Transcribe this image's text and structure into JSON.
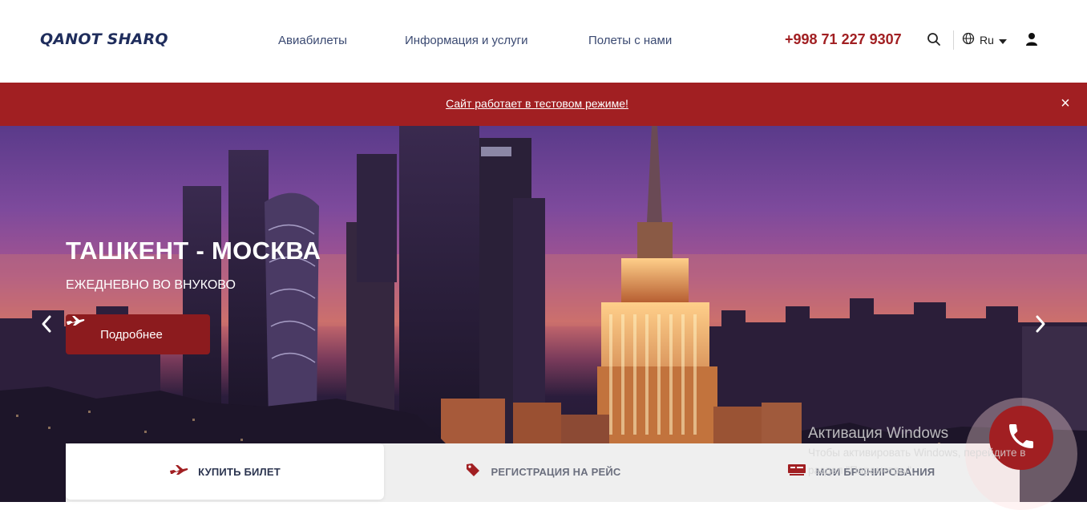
{
  "header": {
    "logo": "QANOT SHARQ",
    "nav": [
      {
        "label": "Авиабилеты"
      },
      {
        "label": "Информация и услуги"
      },
      {
        "label": "Полеты с нами"
      }
    ],
    "phone": "+998 71 227 9307",
    "language": "Ru",
    "icons": [
      "search-icon",
      "globe-icon",
      "user-icon"
    ]
  },
  "notice": {
    "text": "Сайт работает в тестовом режиме!",
    "close": "×"
  },
  "hero": {
    "title": "ТАШКЕНТ - МОСКВА",
    "subtitle": "ЕЖЕДНЕВНО ВО ВНУКОВО",
    "button_label": "Подробнее",
    "icons": [
      "chevron-left-icon",
      "chevron-right-icon",
      "airplane-icon"
    ]
  },
  "booking_tabs": [
    {
      "label": "КУПИТЬ БИЛЕТ",
      "icon": "airplane-icon",
      "active": true
    },
    {
      "label": "РЕГИСТРАЦИЯ НА РЕЙС",
      "icon": "tag-icon",
      "active": false
    },
    {
      "label": "МОИ БРОНИРОВАНИЯ",
      "icon": "ticket-icon",
      "active": false
    }
  ],
  "watermark": {
    "title": "Активация Windows",
    "line1": "Чтобы активировать Windows, перейдите в",
    "line2": "раздел \"Параметры\"."
  },
  "colors": {
    "brand_red": "#a11f22",
    "brand_navy": "#1f2d5c",
    "nav_text": "#3b4a72"
  }
}
